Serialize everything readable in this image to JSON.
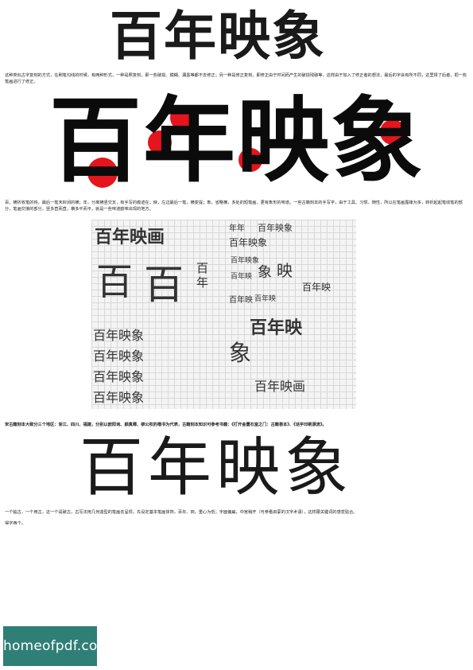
{
  "title_top": "百年映象",
  "paragraph_1": "这种类似古字复刻的方式，在刷笔勾线的时候，有两种形式，一种是照复刻，即一些破损、模糊、漏墨等都不去修正；另一种是修正复刻，即修正由于时间而产生的破损残破等，这样由于加入了修正者的想法，最后的字会有所不同，这里择了后者，把一些笔画进行了修正。",
  "title_big": [
    "百",
    "年",
    "映",
    "象"
  ],
  "paragraph_2": "百，横折收笔的钩，最后一笔末封闭的横；年，分离横竖交叉，有手写的痕迹在；映，左边最后一笔，横变提；象，省略横，多处的短笔画，更有象形的味道。一些古籍刻本的手写字，由于工具、习惯、随性，所以在笔画露锋为多，转折起起笔收笔的部分，笔画交接的部分，竖多直而直，横多平而平，就是一些味道韵味出现的地方。",
  "sketch_words": {
    "left": [
      "百年映画",
      "百年映象",
      "百年映象",
      "百年映象",
      "百年映象",
      "百",
      "百",
      "百年"
    ],
    "right": [
      "年年",
      "百年映象",
      "百年映象",
      "百年映象",
      "百年映",
      "映",
      "象",
      "百年映",
      "百年映",
      "百年映",
      "象",
      "百年映画",
      "百年映"
    ]
  },
  "paragraph_3": "宋古籍刻本大致分三个地区：浙江、四川、福建，分别以欧阳询、颜真卿、柳公权的楷书为代表，古籍刻本知识可参考书籍：《打开金匮石室之门：古籍善本》、《话字印刷源流》。",
  "title_bottom": "百年映象",
  "paragraph_4": "一个临古，一个用古，这一个是破古，古写法用几何造型的笔画去呈现，先设定基本笔画体饰，百年、田，重心为低；字面偏扁，中宫稍开（可参看启蒙的汉字术语），这样跟关键词的感觉贴合。",
  "paragraph_5": "得字西个。",
  "badge": "homeofpdf.com",
  "colors": {
    "accent_red": "#e4151c",
    "badge_bg": "#2f7f76"
  }
}
